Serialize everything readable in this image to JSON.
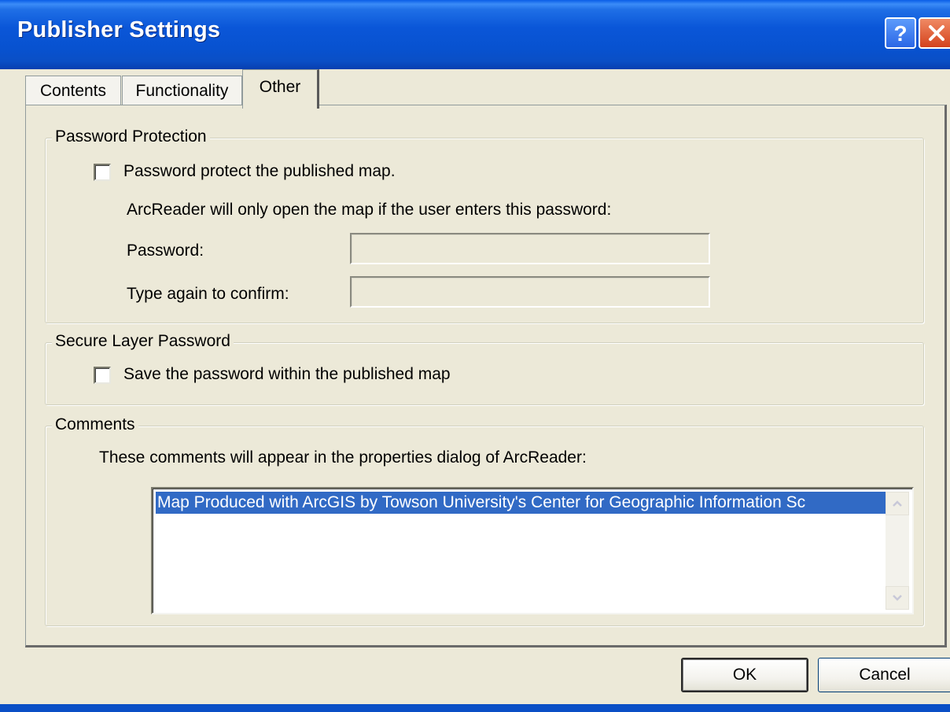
{
  "window": {
    "title": "Publisher Settings",
    "help_icon": "help-question-icon",
    "close_icon": "close-x-icon"
  },
  "tabs": [
    {
      "label": "Contents",
      "selected": false
    },
    {
      "label": "Functionality",
      "selected": false
    },
    {
      "label": "Other",
      "selected": true
    }
  ],
  "password_protection": {
    "group_label": "Password Protection",
    "checkbox_label": "Password protect the published map.",
    "checked": false,
    "info_text": "ArcReader will only open the map if the user enters this password:",
    "password_label": "Password:",
    "password_value": "",
    "confirm_label": "Type again to confirm:",
    "confirm_value": ""
  },
  "secure_layer": {
    "group_label": "Secure Layer Password",
    "checkbox_label": "Save the password within the published map",
    "checked": false
  },
  "comments": {
    "group_label": "Comments",
    "info_text": "These comments will appear in the properties dialog of ArcReader:",
    "value": "Map Produced with ArcGIS by Towson University's Center for Geographic Information Sc"
  },
  "buttons": {
    "ok": "OK",
    "cancel": "Cancel"
  },
  "colors": {
    "titlebar": "#0a56d8",
    "dialog_bg": "#ece9d8",
    "selection": "#316ac5",
    "close_button": "#d4421c"
  }
}
